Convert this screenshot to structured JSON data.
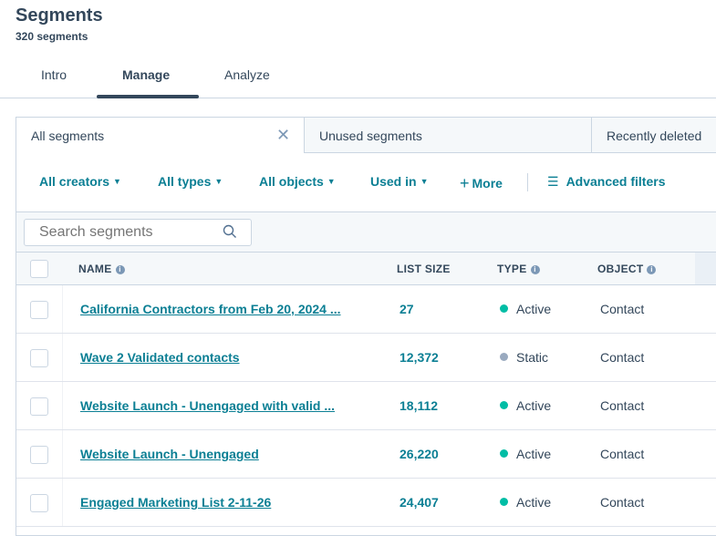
{
  "header": {
    "title": "Segments",
    "count": "320 segments"
  },
  "tabs": [
    "Intro",
    "Manage",
    "Analyze"
  ],
  "active_tab": "Manage",
  "view_tabs": [
    "All segments",
    "Unused segments",
    "Recently deleted"
  ],
  "filters": {
    "creators": "All creators",
    "types": "All types",
    "objects": "All objects",
    "used_in": "Used in",
    "more": "More",
    "advanced": "Advanced filters"
  },
  "search": {
    "placeholder": "Search segments"
  },
  "columns": {
    "name": "NAME",
    "list_size": "LIST SIZE",
    "type": "TYPE",
    "object": "OBJECT"
  },
  "colors": {
    "link": "#0b7f94",
    "active": "#00bda5",
    "static": "#99a9bf"
  },
  "rows": [
    {
      "name": "California Contractors from Feb 20, 2024 ...",
      "size": "27",
      "type": "Active",
      "object": "Contact"
    },
    {
      "name": "Wave 2 Validated contacts",
      "size": "12,372",
      "type": "Static",
      "object": "Contact"
    },
    {
      "name": "Website Launch - Unengaged with valid ...",
      "size": "18,112",
      "type": "Active",
      "object": "Contact"
    },
    {
      "name": "Website Launch - Unengaged",
      "size": "26,220",
      "type": "Active",
      "object": "Contact"
    },
    {
      "name": "Engaged Marketing List 2-11-26",
      "size": "24,407",
      "type": "Active",
      "object": "Contact"
    }
  ]
}
